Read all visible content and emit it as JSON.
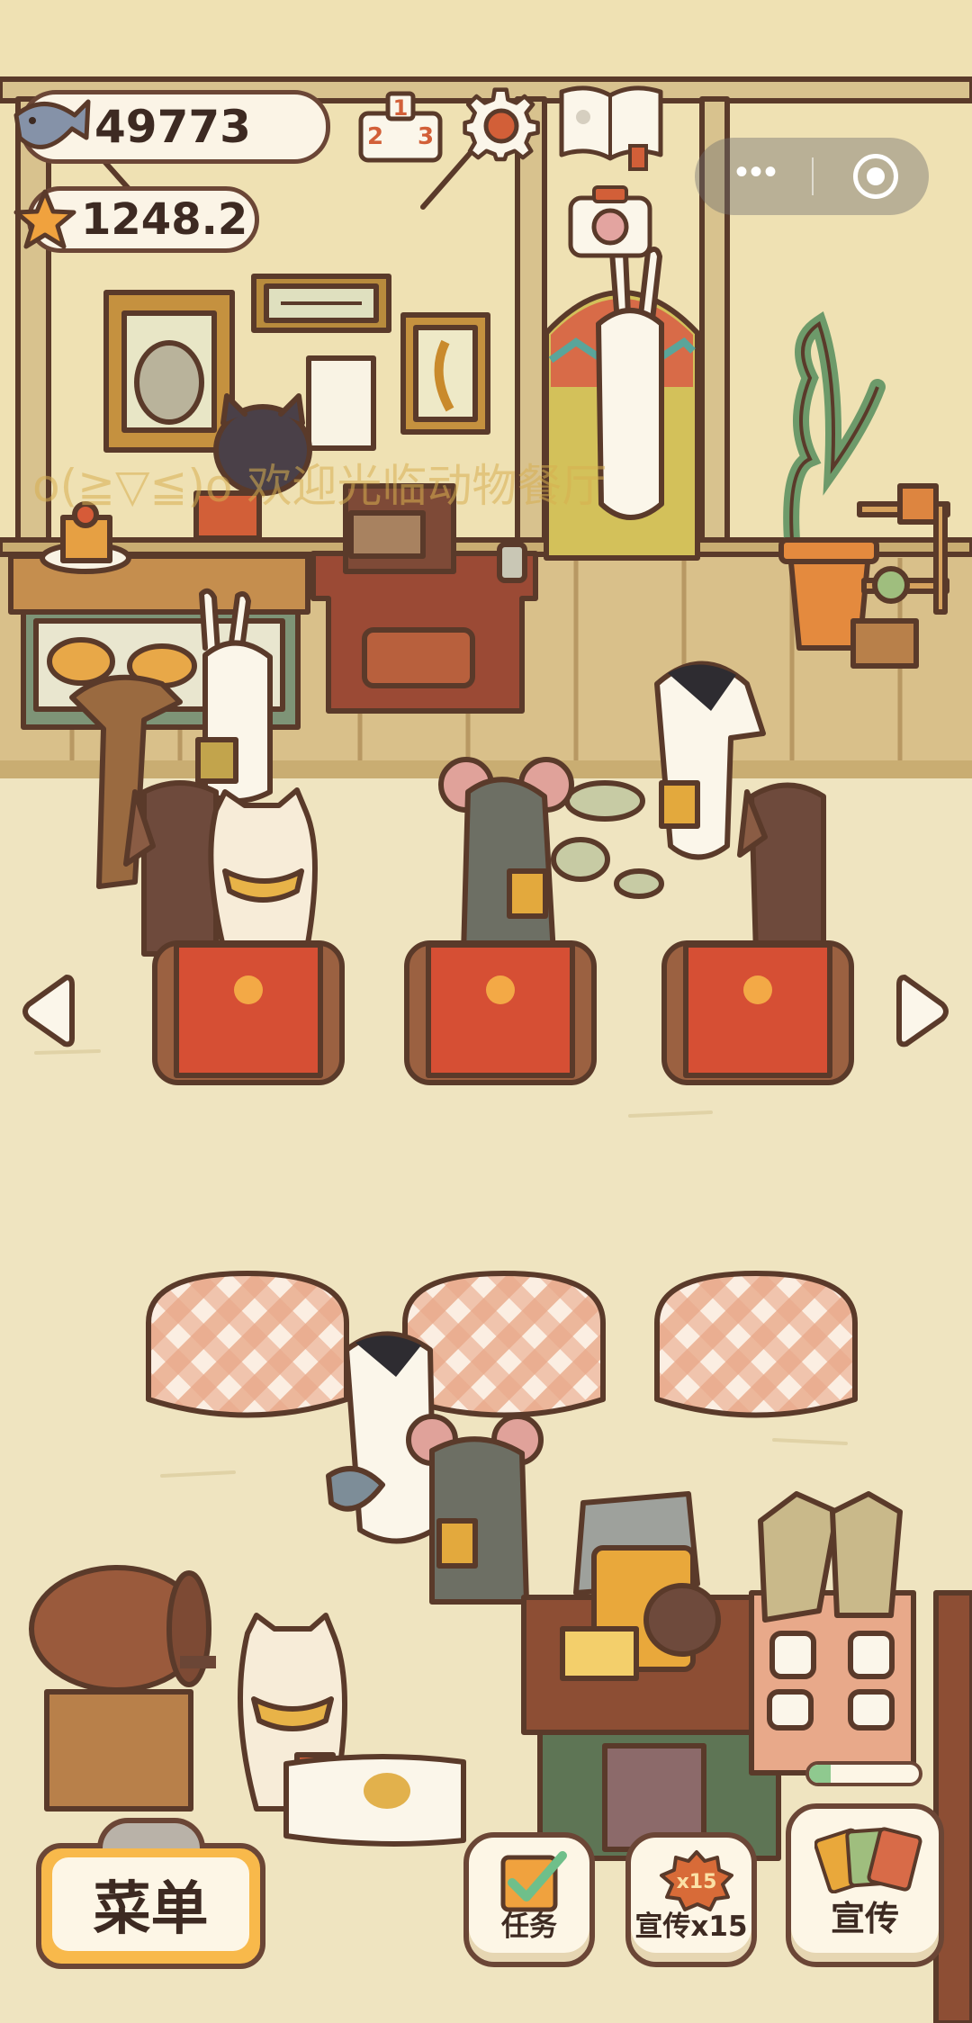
{
  "currency": {
    "fish_count": "49773",
    "stars": "1248.2",
    "fish_icon": "fish-icon",
    "star_icon": "star-icon"
  },
  "top_icons": [
    "ranking-icon",
    "settings-gear-icon",
    "book-icon",
    "camera-icon"
  ],
  "welcome_text": "o(≧▽≦)o 欢迎光临动物餐厅",
  "mini_program": {
    "more": "•••",
    "close_icon": "target-icon"
  },
  "buttons": {
    "menu": "菜单",
    "tasks": "任务",
    "promote_x15": "宣传x15",
    "promote_badge": "x15",
    "promote": "宣传"
  },
  "promotion_progress": 0.2,
  "colors": {
    "wall": "#efe2b6",
    "floor": "#efe4c0",
    "outline": "#5a3a2a",
    "button_orange": "#f8b94b",
    "tablecloth_red": "#d64f34"
  }
}
